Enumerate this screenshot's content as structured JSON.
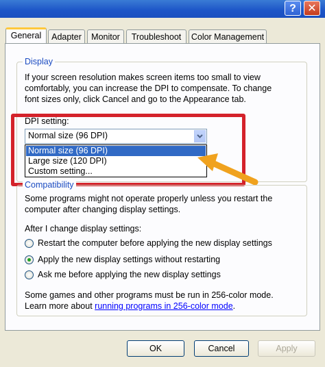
{
  "window": {
    "help_label": "?",
    "close_label": "✕"
  },
  "tabs": [
    {
      "label": "General",
      "active": true
    },
    {
      "label": "Adapter"
    },
    {
      "label": "Monitor"
    },
    {
      "label": "Troubleshoot"
    },
    {
      "label": "Color Management"
    }
  ],
  "display": {
    "legend": "Display",
    "description_1": "If your screen resolution makes screen items too small to view",
    "description_2": "comfortably, you can increase the DPI to compensate.  To change",
    "description_3": "font sizes only, click Cancel and go to the Appearance tab.",
    "dpi_label": "DPI setting:",
    "dpi_selected": "Normal size (96 DPI)",
    "dpi_options": [
      "Normal size (96 DPI)",
      "Large size (120 DPI)",
      "Custom setting..."
    ]
  },
  "compatibility": {
    "legend": "Compatibility",
    "description_1": "Some programs might not operate properly unless you restart the",
    "description_2": "computer after changing display settings.",
    "after_label": "After I change display settings:",
    "options": [
      {
        "label": "Restart the computer before applying the new display settings",
        "checked": false
      },
      {
        "label": "Apply the new display settings without restarting",
        "checked": true
      },
      {
        "label": "Ask me before applying the new display settings",
        "checked": false
      }
    ],
    "note_1": "Some games and other programs must be run in 256-color mode.",
    "note_2_prefix": "Learn more about ",
    "note_2_link": "running programs in 256-color mode",
    "note_2_suffix": "."
  },
  "buttons": {
    "ok": "OK",
    "cancel": "Cancel",
    "apply": "Apply"
  },
  "colors": {
    "highlight": "#d4222a",
    "arrow": "#f0a21e",
    "selection": "#316ac5"
  }
}
